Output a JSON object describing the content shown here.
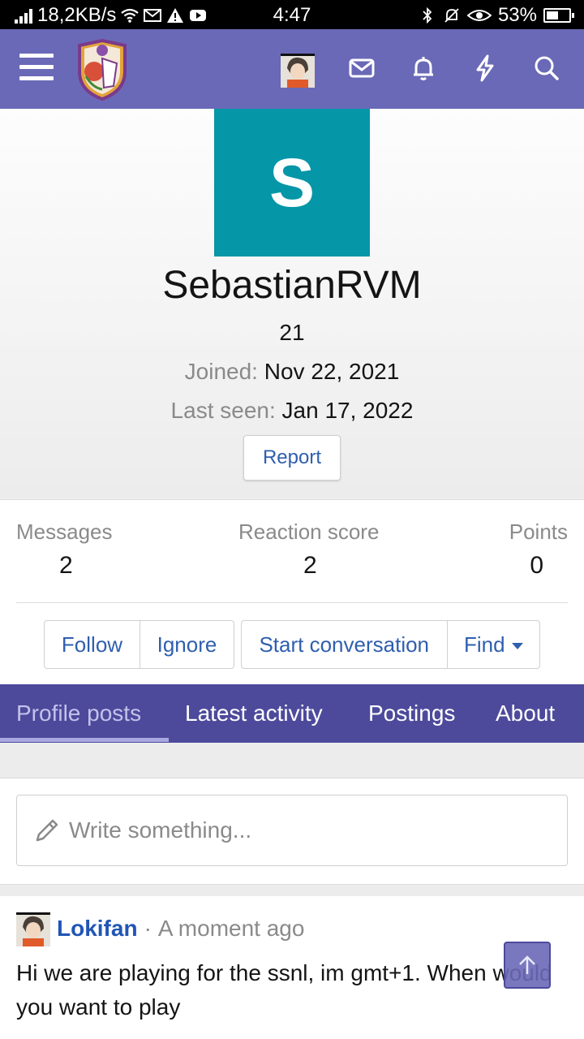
{
  "status_bar": {
    "network_speed": "18,2KB/s",
    "time": "4:47",
    "battery_percent": "53%",
    "battery_level": 0.53
  },
  "header": {
    "icons": [
      "menu-icon",
      "site-logo",
      "user-avatar",
      "envelope-icon",
      "bell-icon",
      "bolt-icon",
      "search-icon"
    ],
    "brand_color": "#6a69b7"
  },
  "profile": {
    "avatar_letter": "S",
    "avatar_color": "#0596a8",
    "username": "SebastianRVM",
    "age": "21",
    "joined_label": "Joined:",
    "joined_value": "Nov 22, 2021",
    "last_seen_label": "Last seen:",
    "last_seen_value": "Jan 17, 2022",
    "report_label": "Report"
  },
  "stats": {
    "messages_label": "Messages",
    "messages_value": "2",
    "reaction_label": "Reaction score",
    "reaction_value": "2",
    "points_label": "Points",
    "points_value": "0"
  },
  "actions": {
    "follow": "Follow",
    "ignore": "Ignore",
    "start_conversation": "Start conversation",
    "find": "Find"
  },
  "tabs": [
    {
      "label": "Profile posts",
      "active": true
    },
    {
      "label": "Latest activity",
      "active": false
    },
    {
      "label": "Postings",
      "active": false
    },
    {
      "label": "About",
      "active": false
    }
  ],
  "composer": {
    "placeholder": "Write something..."
  },
  "post": {
    "author": "Lokifan",
    "separator": "·",
    "time": "A moment ago",
    "body": "Hi we are playing for the ssnl, im gmt+1. When would you want to play"
  }
}
